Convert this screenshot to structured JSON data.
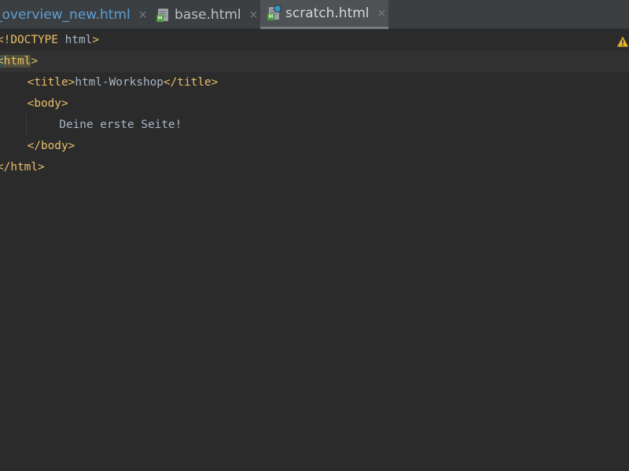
{
  "tabs": [
    {
      "label": "_overview_new.html",
      "close": "×",
      "active": false
    },
    {
      "label": "base.html",
      "close": "×",
      "active": false
    },
    {
      "label": "scratch.html",
      "close": "×",
      "active": true
    }
  ],
  "editor": {
    "lines": [
      {
        "tag_open": "<!DOCTYPE",
        "text": " html",
        "tag_close": ">"
      },
      {
        "bracket_open": "<",
        "name": "html",
        "bracket_close": ">"
      },
      {
        "indent": "    ",
        "tag_open": "<title>",
        "text": "html-Workshop",
        "tag_close": "</title>"
      },
      {
        "indent": "    ",
        "tag_open": "<body>"
      },
      {
        "indent": "        ",
        "text": "Deine erste Seite!"
      },
      {
        "indent": "    ",
        "tag_open": "</body>"
      },
      {
        "tag_open": "</html>"
      }
    ]
  },
  "icons": {
    "file_badge": "H",
    "warning": "warning-icon"
  },
  "colors": {
    "background": "#2b2b2b",
    "tag": "#e8bf6a",
    "text": "#a9b7c6",
    "active_tab": "#4e5254",
    "link_tab": "#5c9fd6",
    "warning": "#e5b42b"
  }
}
